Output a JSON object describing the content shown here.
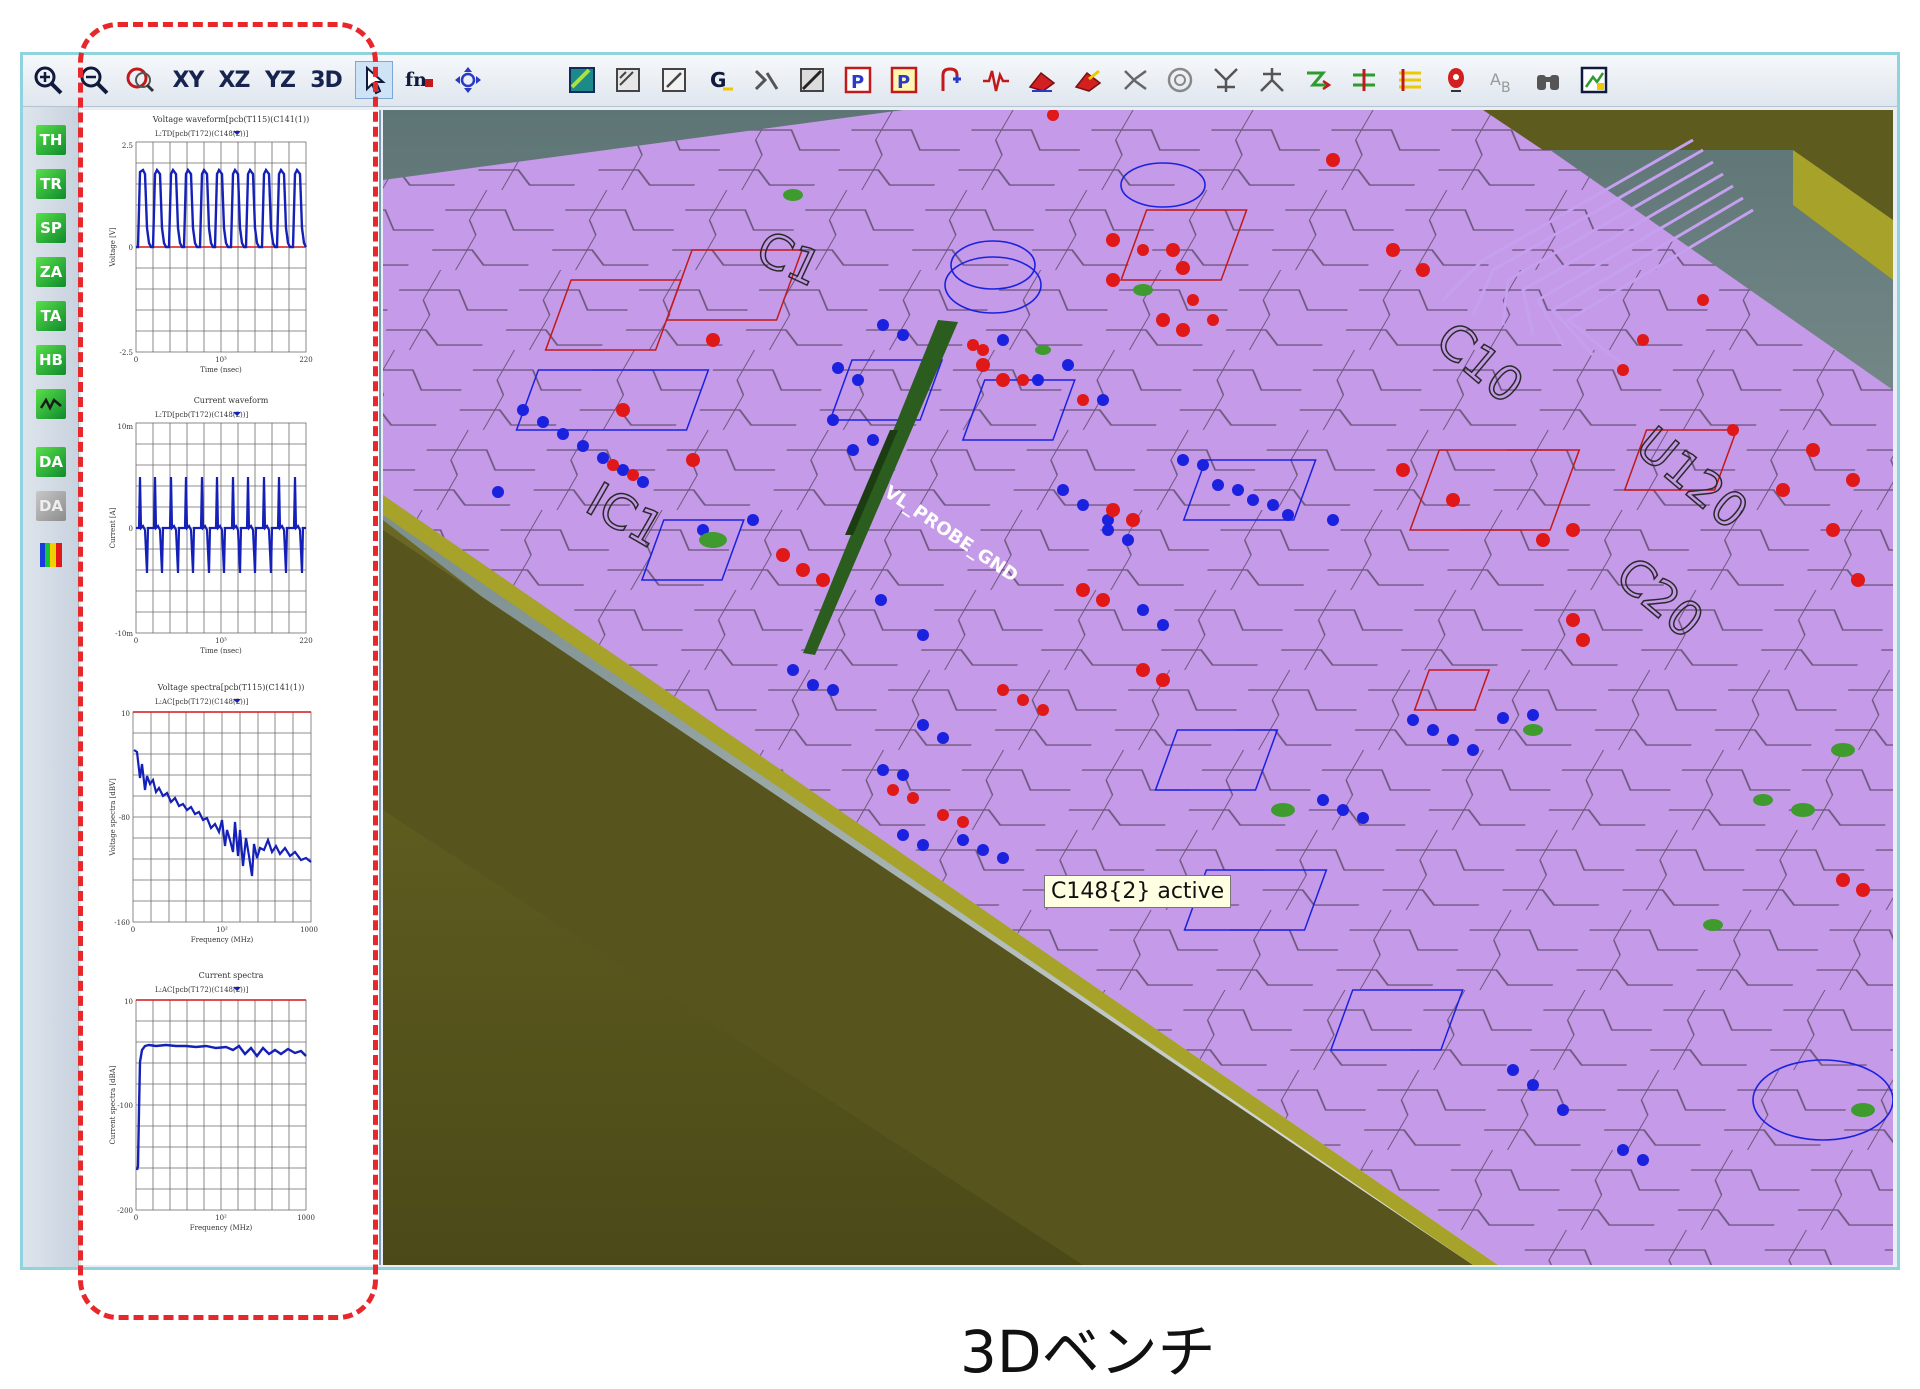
{
  "toolbar": {
    "view_xy": "XY",
    "view_xz": "XZ",
    "view_yz": "YZ",
    "view_3d": "3D",
    "active_tool": "pointer"
  },
  "side_tools": [
    {
      "label": "TH",
      "style": "green"
    },
    {
      "label": "TR",
      "style": "green"
    },
    {
      "label": "SP",
      "style": "green"
    },
    {
      "label": "ZA",
      "style": "green"
    },
    {
      "label": "TA",
      "style": "green"
    },
    {
      "label": "HB",
      "style": "green"
    },
    {
      "label": "DA",
      "style": "green"
    },
    {
      "label": "DA",
      "style": "grey"
    }
  ],
  "graphs": [
    {
      "title": "Voltage waveform[pcb(T115)(C141(1))",
      "legend": "L:TD[pcb(T172)(C148(2))]",
      "ylabel": "Voltage [V]",
      "xlabel": "Time (nsec)",
      "y_top": "2.5",
      "y_mid": "0",
      "y_bottom": "-2.5",
      "x_left": "0",
      "x_mid": "10³",
      "x_right": "220"
    },
    {
      "title": "Current waveform",
      "legend": "L:TD[pcb(T172)(C148(2))]",
      "ylabel": "Current [A]",
      "xlabel": "Time (nsec)",
      "y_top": "10m",
      "y_mid": "0",
      "y_bottom": "-10m",
      "x_left": "0",
      "x_mid": "10³",
      "x_right": "220"
    },
    {
      "title": "Voltage spectra[pcb(T115)(C141(1))",
      "legend": "L:AC[pcb(T172)(C148(2))]",
      "ylabel": "Voltage spectra [dBV]",
      "xlabel": "Frequency (MHz)",
      "y_top": "10",
      "y_mid": "-80",
      "y_bottom": "-160",
      "x_left": "0",
      "x_mid": "10²",
      "x_right": "1000"
    },
    {
      "title": "Current spectra",
      "legend": "L:AC[pcb(T172)(C148(2))]",
      "ylabel": "Current spectra [dBA]",
      "xlabel": "Frequency (MHz)",
      "y_top": "10",
      "y_mid": "-100",
      "y_bottom": "-200",
      "x_left": "0",
      "x_mid": "10²",
      "x_right": "1000"
    }
  ],
  "viewport": {
    "tooltip": "C148{2} active",
    "net_label": "VL_PROBE_GND",
    "silkscreen": [
      "C1",
      "J1",
      "U120",
      "C10",
      "L1",
      "C20",
      "IC1"
    ]
  },
  "caption": "3Dベンチ",
  "colors": {
    "board": "#c59ae8",
    "board_edge": "#5e5b1f",
    "board_rim": "#a7a22a",
    "trace": "#1d1d1d",
    "pad_blue": "#1a22e0",
    "pad_red": "#e01818",
    "waveform": "#1420b8",
    "highlight": "#e8272a",
    "probe": "#2b5d1e"
  }
}
